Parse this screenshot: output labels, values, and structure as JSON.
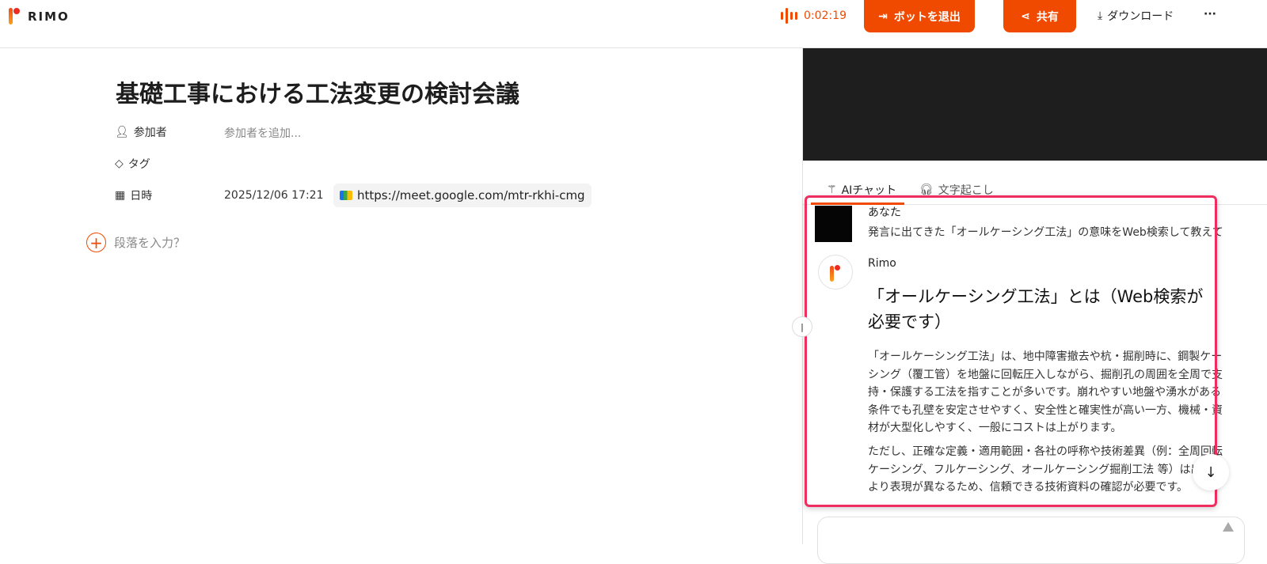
{
  "header": {
    "brand": "RIMO",
    "timer": "0:02:19",
    "leave_bot": "ボットを退出",
    "share": "共有",
    "download": "ダウンロード",
    "more": "···"
  },
  "doc": {
    "title": "基礎工事における工法変更の検討会議",
    "participants_label": "参加者",
    "participants_placeholder": "参加者を追加...",
    "tags_label": "タグ",
    "datetime_label": "日時",
    "datetime": "2025/12/06 17:21",
    "meeting_link": "https://meet.google.com/mtr-rkhi-cmg",
    "add_paragraph": "段落を入力？"
  },
  "panel": {
    "tabs": [
      {
        "label": "AIチャット",
        "active": true
      },
      {
        "label": "文字起こし",
        "active": false
      }
    ],
    "messages": {
      "user": {
        "name": "あなた",
        "text": "発言に出てきた「オールケーシング工法」の意味をWeb検索して教えて"
      },
      "bot": {
        "name": "Rimo",
        "heading": "「オールケーシング工法」とは（Web検索が必要です）",
        "paragraphs": [
          "「オールケーシング工法」は、地中障害撤去や杭・掘削時に、鋼製ケーシング（覆工管）を地盤に回転圧入しながら、掘削孔の周囲を全周で支持・保護する工法を指すことが多いです。崩れやすい地盤や湧水がある条件でも孔壁を安定させやすく、安全性と確実性が高い一方、機械・資材が大型化しやすく、一般にコストは上がります。",
          "ただし、正確な定義・適用範囲・各社の呼称や技術差異（例：全周回転ケーシング、フルケーシング、オールケーシング掘削工法 等）は出典により表現が異なるため、信頼できる技術資料の確認が必要です。"
        ]
      }
    },
    "highlight_color": "#ef2d5e"
  },
  "colors": {
    "accent": "#f04a00"
  }
}
